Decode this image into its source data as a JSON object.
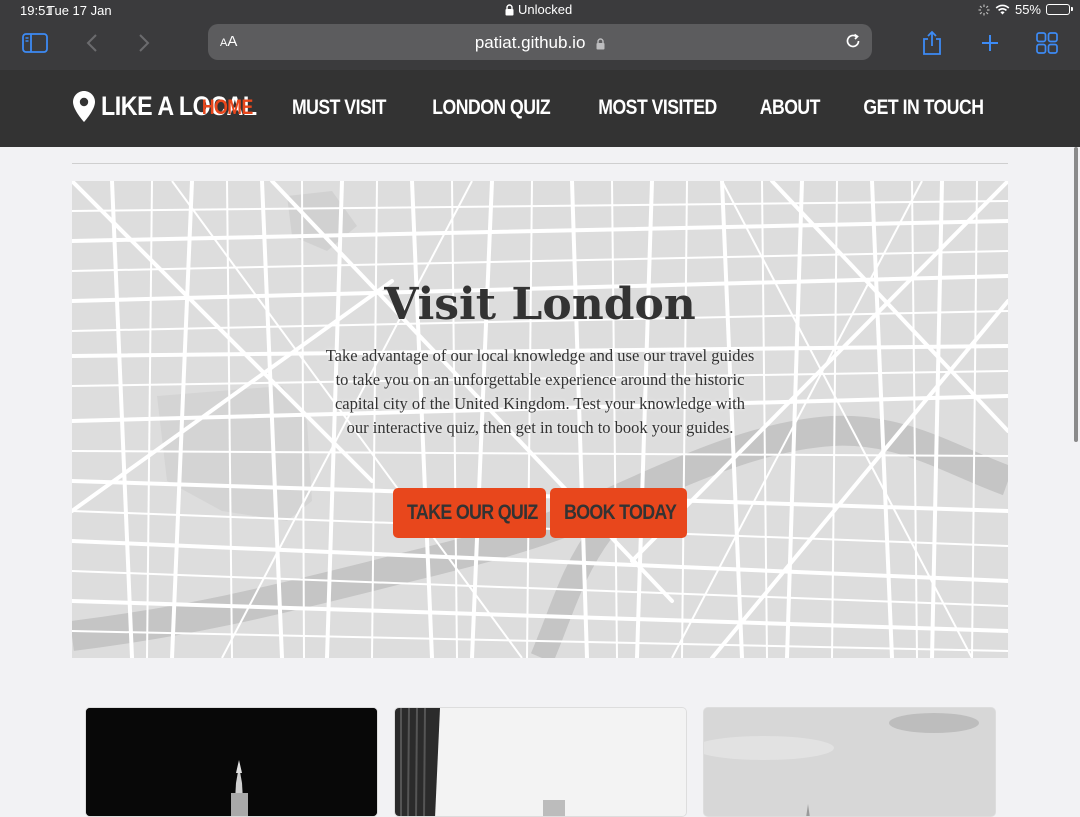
{
  "status": {
    "time": "19:51",
    "date": "Tue 17 Jan",
    "lock_text": "Unlocked",
    "battery": "55%"
  },
  "browser": {
    "aa_small": "A",
    "aa_large": "A",
    "url": "patiat.github.io"
  },
  "site": {
    "brand": "LIKE A LOCAL",
    "nav": [
      {
        "label": "HOME",
        "active": true
      },
      {
        "label": "MUST VISIT"
      },
      {
        "label": "LONDON QUIZ"
      },
      {
        "label": "MOST VISITED"
      },
      {
        "label": "ABOUT"
      },
      {
        "label": "GET IN TOUCH"
      }
    ]
  },
  "hero": {
    "title": "Visit London",
    "text": "Take advantage of our local knowledge and use our travel guides to take you on an unforgettable experience around the historic capital city of the United Kingdom. Test your knowledge with our interactive quiz, then get in touch to book your guides.",
    "buttons": [
      {
        "label": "TAKE OUR QUIZ"
      },
      {
        "label": "BOOK TODAY"
      }
    ]
  },
  "colors": {
    "accent": "#e8471c",
    "nav_bg": "#333333",
    "chrome_bg": "#3b3b3d"
  }
}
